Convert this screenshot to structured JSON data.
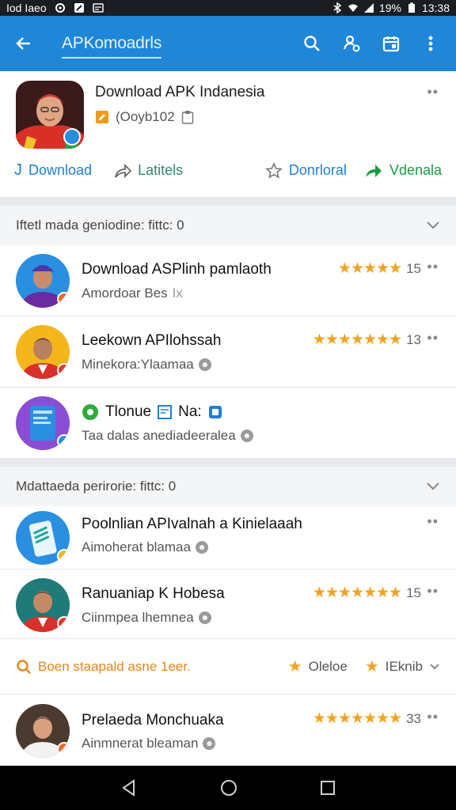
{
  "status_bar": {
    "left_text": "Iod Iaeo",
    "battery_pct": "19%",
    "time": "13:38"
  },
  "app_bar": {
    "title": "APKomoadrls"
  },
  "hero": {
    "title": "Download APK Indanesia",
    "subtitle": "(Ooyb102",
    "actions": {
      "download": "Download",
      "share": "Latitels",
      "download2": "Donrloral",
      "forward": "Vdenala"
    }
  },
  "section1": {
    "header": "Iftetl mada geniodine: fittc: 0",
    "items": [
      {
        "name": "Download ASPlinh pamlaoth",
        "sub": "Amordoar Bes",
        "rating": "15",
        "stars": "★★★★★"
      },
      {
        "name": "Leekown APIlohssah",
        "sub": "Minekora:Ylaamaa",
        "rating": "13",
        "stars": "★★★★★★★"
      },
      {
        "name": "Tlonue",
        "name_extra": "Na:",
        "sub": "Taa dalas anediadeeralea",
        "rating": "",
        "stars": ""
      }
    ]
  },
  "section2": {
    "header": "Mdattaeda perirorie: fittc: 0",
    "items": [
      {
        "name": "Poolnlian APIvalnah a Kinielaaah",
        "sub": "Aimoherat blamaa",
        "rating": "",
        "stars": ""
      },
      {
        "name": "Ranuaniap K Hobesa",
        "sub": "Ciinmpea lhemnea",
        "rating": "15",
        "stars": "★★★★★★★"
      }
    ]
  },
  "filter": {
    "search_text": "Boen staapald asne 1eer.",
    "chip1": "Oleloe",
    "chip2": "IEknib"
  },
  "last_item": {
    "name": "Prelaeda Monchuaka",
    "sub": "Ainmnerat bleaman",
    "rating": "33",
    "stars": "★★★★★★★"
  },
  "colors": {
    "app_bar": "#1f86d8",
    "accent_blue": "#1e7fd6",
    "star": "#f1a321",
    "green": "#1c9a45"
  }
}
